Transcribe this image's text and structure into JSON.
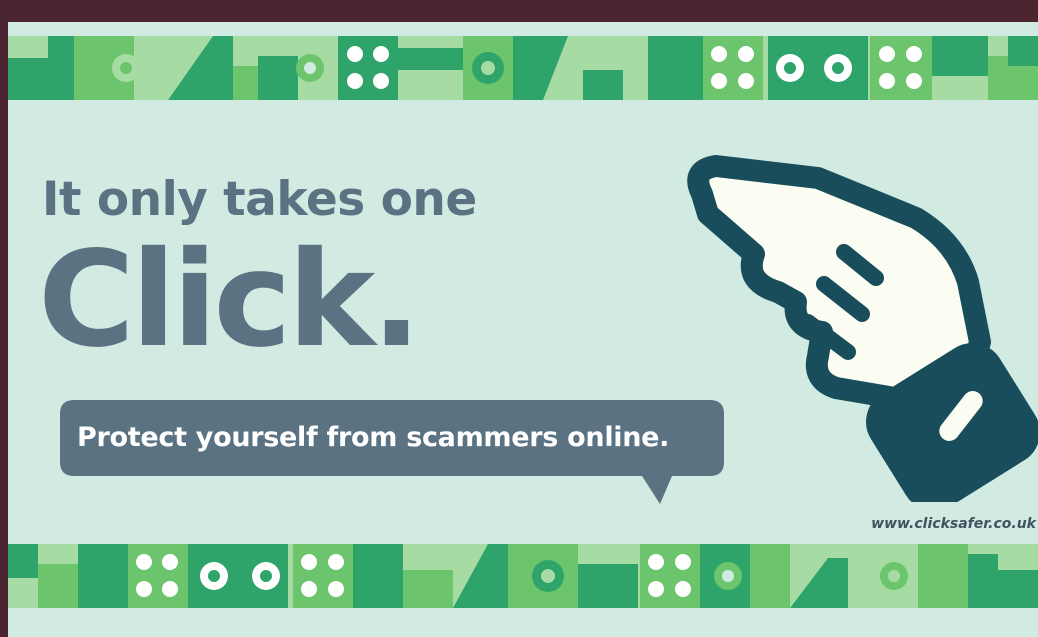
{
  "headline": {
    "line1": "It only takes one",
    "line2": "Click."
  },
  "tagline": "Protect yourself from scammers online.",
  "website": "www.clicksafer.co.uk",
  "colors": {
    "outer_frame": "#4a2530",
    "background": "#d2ebe2",
    "text_slate": "#5a7282",
    "hand_outline": "#194d5b",
    "green_dark": "#2ea46a",
    "green_mid": "#6cc46c",
    "green_light": "#a6dca4"
  },
  "icons": [
    "pointing-hand-icon",
    "pattern-dots-icon",
    "pattern-circles-icon"
  ]
}
